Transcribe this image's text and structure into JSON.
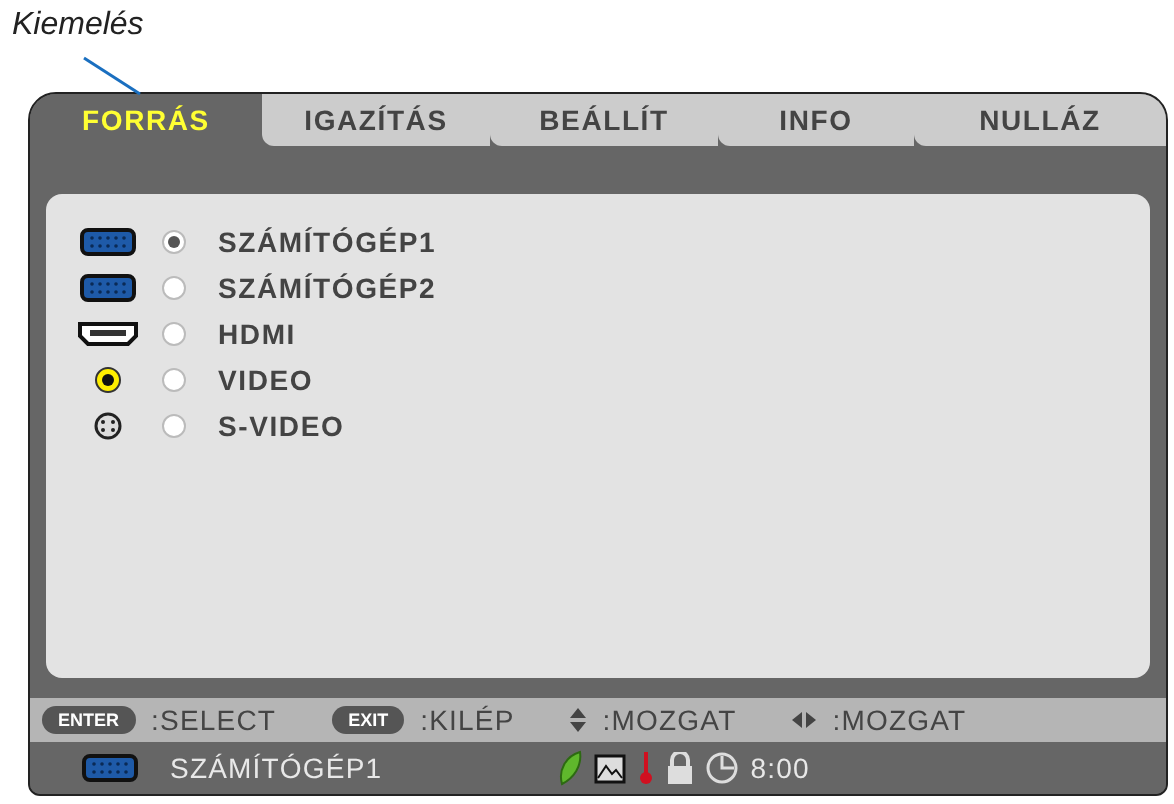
{
  "annotation": {
    "label": "Kiemelés"
  },
  "tabs": [
    {
      "label": "FORRÁS",
      "selected": true
    },
    {
      "label": "IGAZÍTÁS",
      "selected": false
    },
    {
      "label": "BEÁLLÍT",
      "selected": false
    },
    {
      "label": "INFO",
      "selected": false
    },
    {
      "label": "NULLÁZ",
      "selected": false
    }
  ],
  "sources": [
    {
      "label": "SZÁMÍTÓGÉP1",
      "kind": "vga",
      "selected": true
    },
    {
      "label": "SZÁMÍTÓGÉP2",
      "kind": "vga",
      "selected": false
    },
    {
      "label": "HDMI",
      "kind": "hdmi",
      "selected": false
    },
    {
      "label": "VIDEO",
      "kind": "rca",
      "selected": false
    },
    {
      "label": "S-VIDEO",
      "kind": "svideo",
      "selected": false
    }
  ],
  "hints": [
    {
      "kind": "badge",
      "key": "ENTER",
      "action": ":SELECT"
    },
    {
      "kind": "badge",
      "key": "EXIT",
      "action": ":KILÉP"
    },
    {
      "kind": "updown",
      "action": ":MOZGAT"
    },
    {
      "kind": "leftright",
      "action": ":MOZGAT"
    }
  ],
  "status": {
    "source": "SZÁMÍTÓGÉP1",
    "time": "8:00"
  }
}
